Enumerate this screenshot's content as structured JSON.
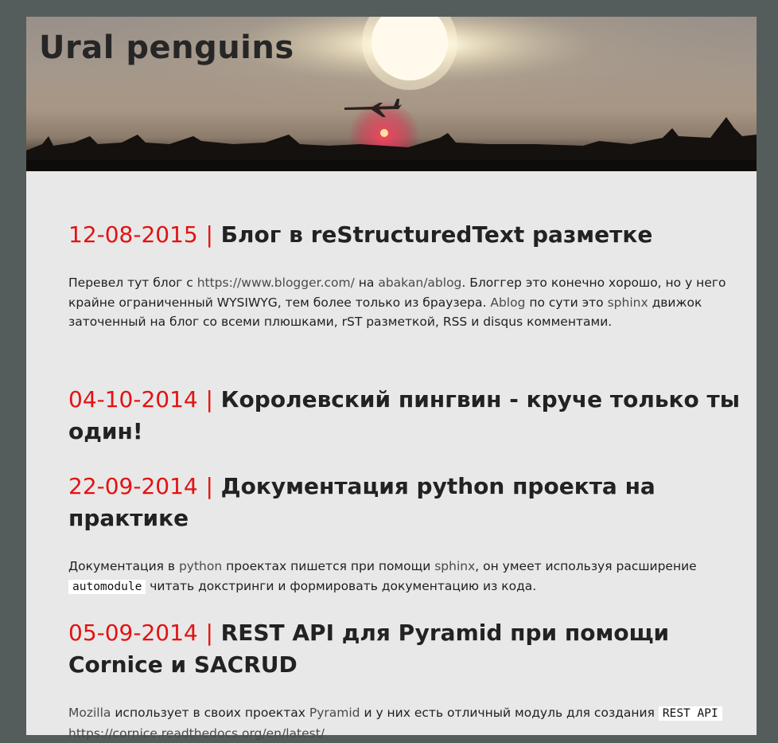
{
  "site": {
    "title": "Ural penguins"
  },
  "posts": [
    {
      "date": "12-08-2015",
      "separator": "|",
      "title": "Блог в reStructuredText разметке",
      "body": {
        "t1": "Перевел тут блог с ",
        "l1": "https://www.blogger.com/",
        "t2": " на ",
        "l2": "abakan/ablog",
        "t3": ". Блоггер это конечно хорошо, но у него крайне ограниченный WYSIWYG, тем более только из браузера. ",
        "l3": "Ablog",
        "t4": " по сути это ",
        "l4": "sphinx",
        "t5": " движок заточенный на блог со всеми плюшками, rST разметкой, RSS и disqus комментами."
      }
    },
    {
      "date": "04-10-2014",
      "separator": "|",
      "title": "Королевский пингвин - круче только ты один!"
    },
    {
      "date": "22-09-2014",
      "separator": "|",
      "title": "Документация python проекта на практике",
      "body": {
        "t1": "Документация в ",
        "l1": "python",
        "t2": " проектах пишется при помощи ",
        "l2": "sphinx",
        "t3": ", он умеет используя расширение ",
        "code": "automodule",
        "t4": " читать докстринги и формировать документацию из кода."
      }
    },
    {
      "date": "05-09-2014",
      "separator": "|",
      "title": "REST API для Pyramid при помощи Cornice и SACRUD",
      "body": {
        "l1": "Mozilla",
        "t1": " использует в своих проектах ",
        "l2": "Pyramid",
        "t2": " и у них есть отличный модуль для создания ",
        "code": "REST API",
        "l3": "https://cornice.readthedocs.org/en/latest/"
      }
    }
  ],
  "colors": {
    "date": "#e31212",
    "background": "#555d5c",
    "page": "#e8e8e8"
  },
  "icons": [
    "airplane-silhouette",
    "sun"
  ]
}
